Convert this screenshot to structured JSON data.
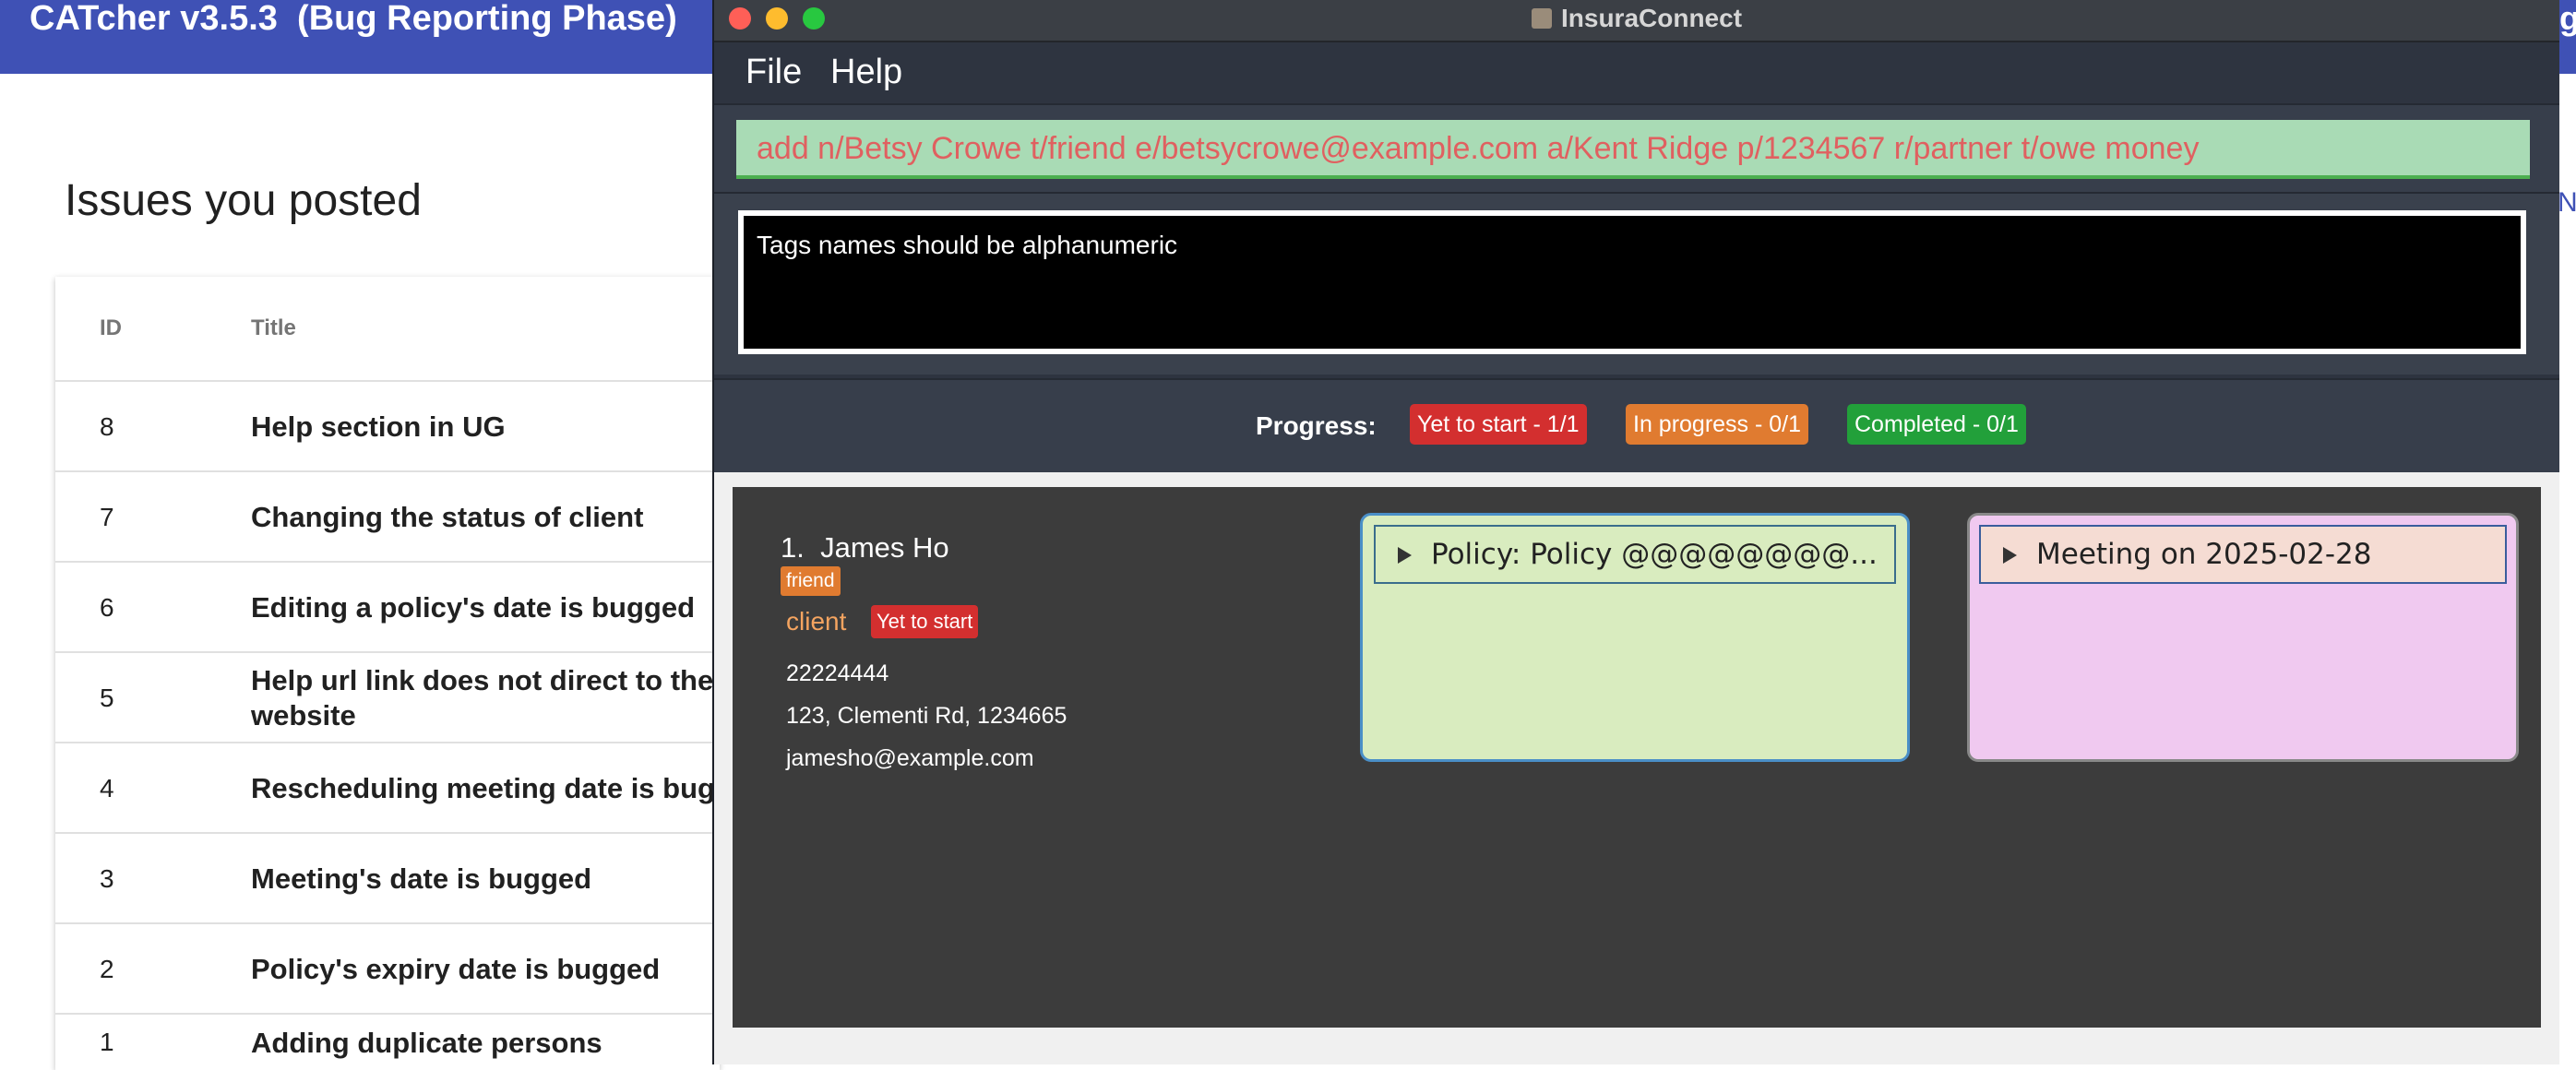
{
  "background_app": {
    "header_title": "CATcher v3.5.3  (Bug Reporting Phase)",
    "right_edge_header": "g",
    "right_edge_link": "Ne",
    "page_title": "Issues you posted",
    "table": {
      "headers": {
        "id": "ID",
        "title": "Title"
      },
      "rows": [
        {
          "id": "8",
          "title": "Help section in UG"
        },
        {
          "id": "7",
          "title": "Changing the status of client"
        },
        {
          "id": "6",
          "title": "Editing a policy's date is bugged"
        },
        {
          "id": "5",
          "title": "Help url link does not direct to the r\nwebsite"
        },
        {
          "id": "4",
          "title": "Rescheduling meeting date is bugg"
        },
        {
          "id": "3",
          "title": "Meeting's date is bugged"
        },
        {
          "id": "2",
          "title": "Policy's expiry date is bugged"
        },
        {
          "id": "1",
          "title": "Adding duplicate persons"
        }
      ]
    }
  },
  "window": {
    "title": "InsuraConnect",
    "icon": "app-icon",
    "menu": {
      "file": "File",
      "help": "Help"
    },
    "command_box": {
      "value": "add n/Betsy Crowe t/friend e/betsycrowe@example.com a/Kent Ridge p/1234567 r/partner t/owe money"
    },
    "result_display": "Tags names should be alphanumeric",
    "progress": {
      "label": "Progress:",
      "yet_to_start": "Yet to start - 1/1",
      "in_progress": "In progress - 0/1",
      "completed": "Completed - 0/1"
    },
    "person_card": {
      "index_name": "1.  James Ho",
      "tag": "friend",
      "role": "client",
      "status": "Yet to start",
      "phone": "22224444",
      "address": "123, Clementi Rd, 1234665",
      "email": "jamesho@example.com",
      "policy_summary": "Policy: Policy @@@@@@@@...",
      "meeting_summary": "Meeting on 2025-02-28"
    }
  },
  "colors": {
    "catcher_header": "#3f51b5",
    "command_box": "#a9dbb5",
    "command_text": "#e06060",
    "status_red": "#d32f2f",
    "status_orange": "#e07b30",
    "status_green": "#22a03a",
    "policy_bg": "#d9ecbf",
    "meeting_bg": "#f0c9f0"
  }
}
